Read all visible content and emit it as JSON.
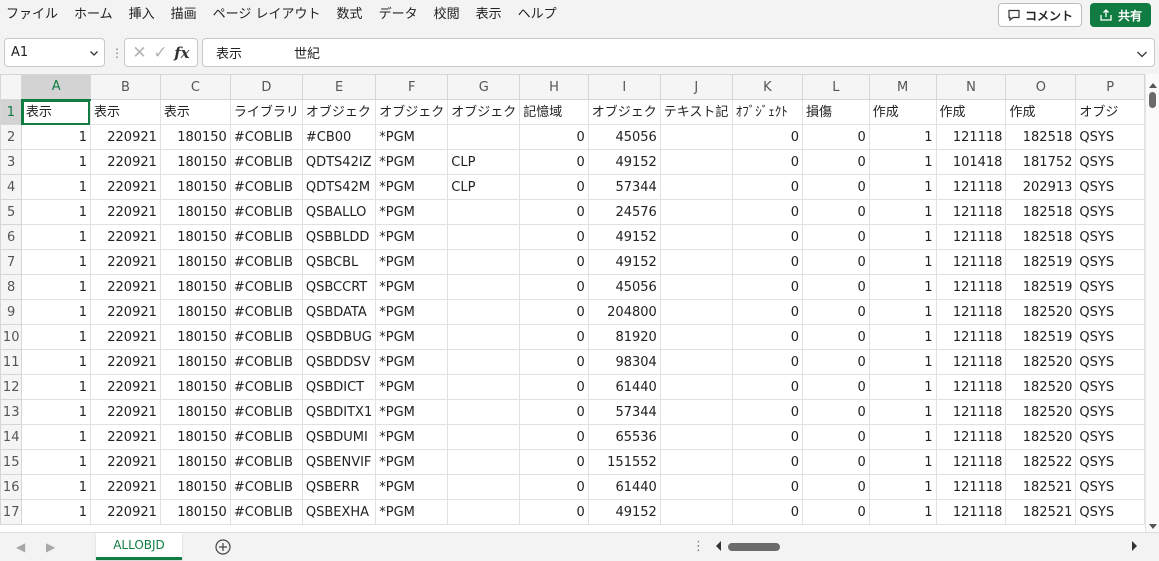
{
  "menu": {
    "items": [
      "ファイル",
      "ホーム",
      "挿入",
      "描画",
      "ページ レイアウト",
      "数式",
      "データ",
      "校閲",
      "表示",
      "ヘルプ"
    ],
    "comment_label": "コメント",
    "share_label": "共有"
  },
  "formula_bar": {
    "name_box": "A1",
    "formula": "表示　　　　世紀",
    "fx_label": "fx"
  },
  "sheet": {
    "columns": [
      "A",
      "B",
      "C",
      "D",
      "E",
      "F",
      "G",
      "H",
      "I",
      "J",
      "K",
      "L",
      "M",
      "N",
      "O",
      "P"
    ],
    "header_row": [
      "表示",
      "表示",
      "表示",
      "ライブラリ",
      "オブジェク",
      "オブジェク",
      "オブジェク",
      "記憶域",
      "オブジェク",
      "テキスト記",
      "ｵﾌﾞｼﾞｪｸﾄ",
      "損傷",
      "作成",
      "作成",
      "作成",
      "オブジ"
    ],
    "rows": [
      {
        "num": "2",
        "cells": [
          "1",
          "220921",
          "180150",
          "#COBLIB",
          "#CB00",
          "*PGM",
          "",
          "0",
          "45056",
          "",
          "0",
          "0",
          "1",
          "121118",
          "182518",
          "QSYS"
        ]
      },
      {
        "num": "3",
        "cells": [
          "1",
          "220921",
          "180150",
          "#COBLIB",
          "QDTS42IZ",
          "*PGM",
          "CLP",
          "0",
          "49152",
          "",
          "0",
          "0",
          "1",
          "101418",
          "181752",
          "QSYS"
        ]
      },
      {
        "num": "4",
        "cells": [
          "1",
          "220921",
          "180150",
          "#COBLIB",
          "QDTS42M",
          "*PGM",
          "CLP",
          "0",
          "57344",
          "",
          "0",
          "0",
          "1",
          "121118",
          "202913",
          "QSYS"
        ]
      },
      {
        "num": "5",
        "cells": [
          "1",
          "220921",
          "180150",
          "#COBLIB",
          "QSBALLO",
          "*PGM",
          "",
          "0",
          "24576",
          "",
          "0",
          "0",
          "1",
          "121118",
          "182518",
          "QSYS"
        ]
      },
      {
        "num": "6",
        "cells": [
          "1",
          "220921",
          "180150",
          "#COBLIB",
          "QSBBLDD",
          "*PGM",
          "",
          "0",
          "49152",
          "",
          "0",
          "0",
          "1",
          "121118",
          "182518",
          "QSYS"
        ]
      },
      {
        "num": "7",
        "cells": [
          "1",
          "220921",
          "180150",
          "#COBLIB",
          "QSBCBL",
          "*PGM",
          "",
          "0",
          "49152",
          "",
          "0",
          "0",
          "1",
          "121118",
          "182519",
          "QSYS"
        ]
      },
      {
        "num": "8",
        "cells": [
          "1",
          "220921",
          "180150",
          "#COBLIB",
          "QSBCCRT",
          "*PGM",
          "",
          "0",
          "45056",
          "",
          "0",
          "0",
          "1",
          "121118",
          "182519",
          "QSYS"
        ]
      },
      {
        "num": "9",
        "cells": [
          "1",
          "220921",
          "180150",
          "#COBLIB",
          "QSBDATA",
          "*PGM",
          "",
          "0",
          "204800",
          "",
          "0",
          "0",
          "1",
          "121118",
          "182520",
          "QSYS"
        ]
      },
      {
        "num": "10",
        "cells": [
          "1",
          "220921",
          "180150",
          "#COBLIB",
          "QSBDBUG",
          "*PGM",
          "",
          "0",
          "81920",
          "",
          "0",
          "0",
          "1",
          "121118",
          "182519",
          "QSYS"
        ]
      },
      {
        "num": "11",
        "cells": [
          "1",
          "220921",
          "180150",
          "#COBLIB",
          "QSBDDSV",
          "*PGM",
          "",
          "0",
          "98304",
          "",
          "0",
          "0",
          "1",
          "121118",
          "182520",
          "QSYS"
        ]
      },
      {
        "num": "12",
        "cells": [
          "1",
          "220921",
          "180150",
          "#COBLIB",
          "QSBDICT",
          "*PGM",
          "",
          "0",
          "61440",
          "",
          "0",
          "0",
          "1",
          "121118",
          "182520",
          "QSYS"
        ]
      },
      {
        "num": "13",
        "cells": [
          "1",
          "220921",
          "180150",
          "#COBLIB",
          "QSBDITX1",
          "*PGM",
          "",
          "0",
          "57344",
          "",
          "0",
          "0",
          "1",
          "121118",
          "182520",
          "QSYS"
        ]
      },
      {
        "num": "14",
        "cells": [
          "1",
          "220921",
          "180150",
          "#COBLIB",
          "QSBDUMI",
          "*PGM",
          "",
          "0",
          "65536",
          "",
          "0",
          "0",
          "1",
          "121118",
          "182520",
          "QSYS"
        ]
      },
      {
        "num": "15",
        "cells": [
          "1",
          "220921",
          "180150",
          "#COBLIB",
          "QSBENVIF",
          "*PGM",
          "",
          "0",
          "151552",
          "",
          "0",
          "0",
          "1",
          "121118",
          "182522",
          "QSYS"
        ]
      },
      {
        "num": "16",
        "cells": [
          "1",
          "220921",
          "180150",
          "#COBLIB",
          "QSBERR",
          "*PGM",
          "",
          "0",
          "61440",
          "",
          "0",
          "0",
          "1",
          "121118",
          "182521",
          "QSYS"
        ]
      },
      {
        "num": "17",
        "cells": [
          "1",
          "220921",
          "180150",
          "#COBLIB",
          "QSBEXHA",
          "*PGM",
          "",
          "0",
          "49152",
          "",
          "0",
          "0",
          "1",
          "121118",
          "182521",
          "QSYS"
        ]
      }
    ],
    "tab_name": "ALLOBJD"
  },
  "icons": {
    "comment": "comment-icon",
    "share": "share-icon",
    "add_sheet": "plus-circle-icon"
  },
  "colors": {
    "accent": "#107c41"
  }
}
